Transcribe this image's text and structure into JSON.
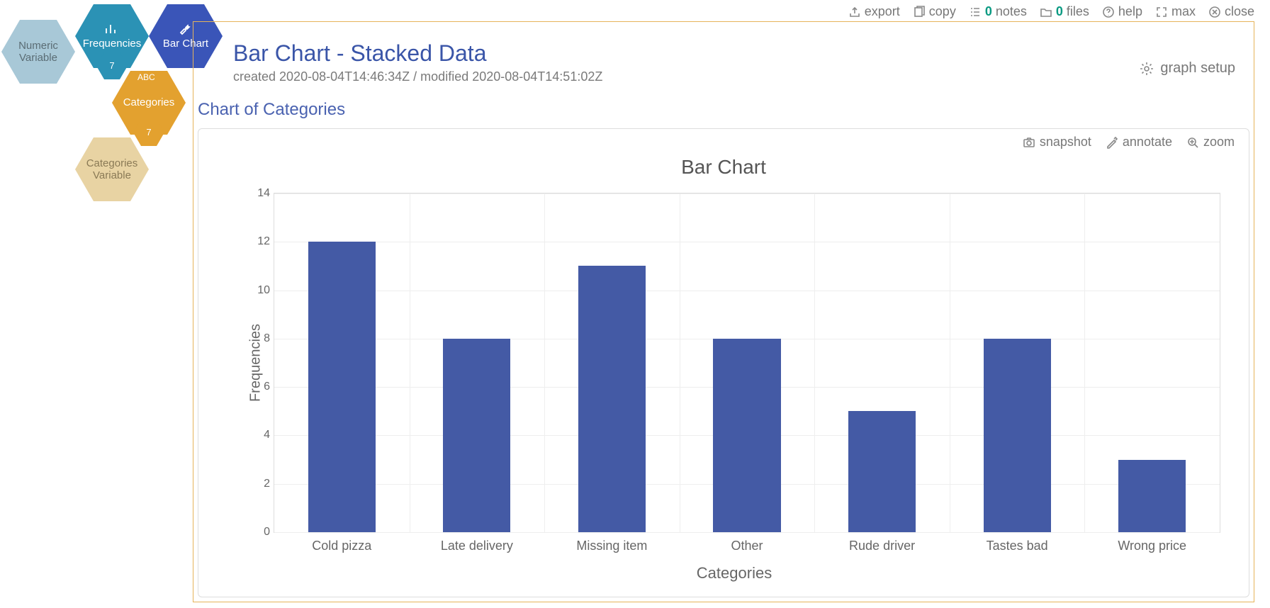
{
  "toolbar": {
    "export": "export",
    "copy": "copy",
    "notes": "notes",
    "notes_n": "0",
    "files": "files",
    "files_n": "0",
    "help": "help",
    "max": "max",
    "close": "close"
  },
  "hex": {
    "numvar": "Numeric Variable",
    "freq": "Frequencies",
    "freq_n": "7",
    "bar": "Bar Chart",
    "cats": "Categories",
    "cats_abc": "ABC",
    "cats_n": "7",
    "catsvar": "Categories Variable"
  },
  "page": {
    "title": "Bar Chart - Stacked Data",
    "meta": "created 2020-08-04T14:46:34Z / modified 2020-08-04T14:51:02Z",
    "graph_setup": "graph setup",
    "subtitle": "Chart of Categories"
  },
  "card_tools": {
    "snapshot": "snapshot",
    "annotate": "annotate",
    "zoom": "zoom"
  },
  "chart_data": {
    "type": "bar",
    "title": "Bar Chart",
    "xlabel": "Categories",
    "ylabel": "Frequencies",
    "ylim": [
      0,
      14
    ],
    "yticks": [
      0,
      2,
      4,
      6,
      8,
      10,
      12,
      14
    ],
    "categories": [
      "Cold pizza",
      "Late delivery",
      "Missing item",
      "Other",
      "Rude driver",
      "Tastes bad",
      "Wrong price"
    ],
    "values": [
      12,
      8,
      11,
      8,
      5,
      8,
      3
    ],
    "bar_color": "#445aa5"
  }
}
